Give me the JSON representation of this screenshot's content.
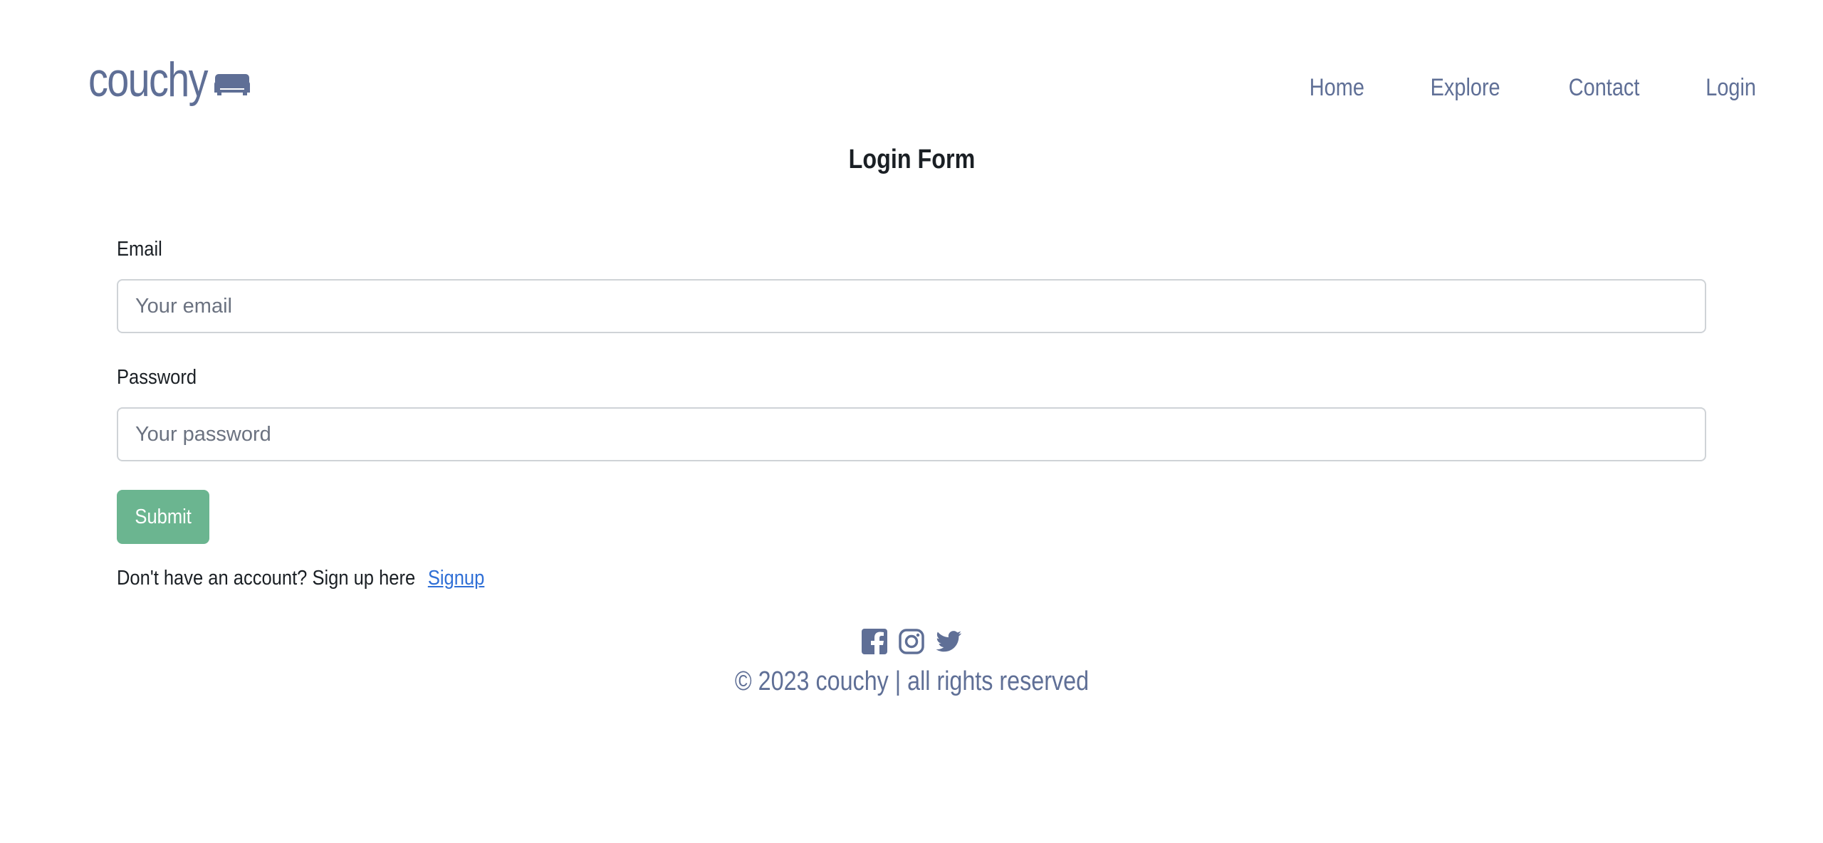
{
  "brand": {
    "name": "couchy",
    "icon": "sofa-icon",
    "color": "#5f6f96"
  },
  "nav": {
    "items": [
      {
        "label": "Home"
      },
      {
        "label": "Explore"
      },
      {
        "label": "Contact"
      },
      {
        "label": "Login"
      }
    ]
  },
  "page": {
    "title": "Login Form"
  },
  "form": {
    "email": {
      "label": "Email",
      "placeholder": "Your email",
      "value": ""
    },
    "password": {
      "label": "Password",
      "placeholder": "Your password",
      "value": ""
    },
    "submit_label": "Submit",
    "submit_color": "#6bb590",
    "signup_prompt": "Don't have an account? Sign up here",
    "signup_link": "Signup",
    "link_color": "#2f6fd6"
  },
  "footer": {
    "social": [
      {
        "icon": "facebook-icon"
      },
      {
        "icon": "instagram-icon"
      },
      {
        "icon": "twitter-icon"
      }
    ],
    "copyright": "© 2023 couchy | all rights reserved"
  }
}
